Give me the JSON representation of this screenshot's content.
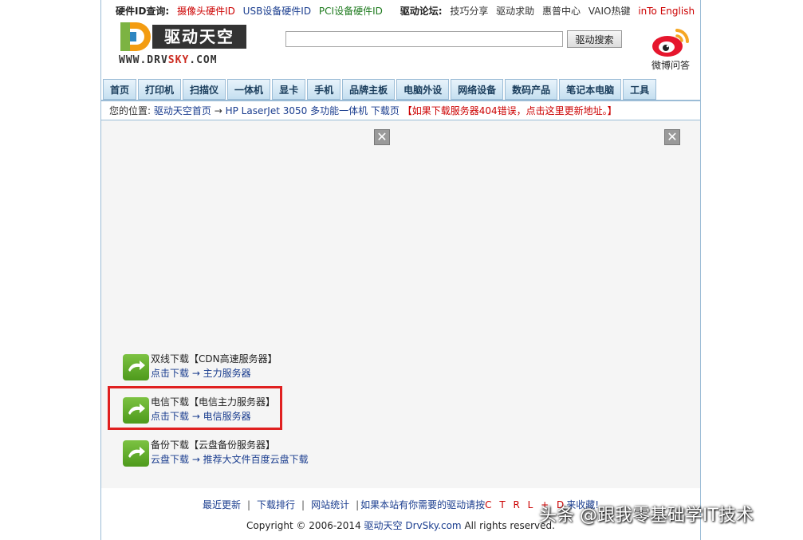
{
  "topbar": {
    "hwid_label": "硬件ID查询:",
    "camera_id": "摄像头硬件ID",
    "usb_id": "USB设备硬件ID",
    "pci_id": "PCI设备硬件ID",
    "forum_label": "驱动论坛:",
    "tips": "技巧分享",
    "help": "驱动求助",
    "hp_center": "惠普中心",
    "vaio": "VAIO热键",
    "english": "inTo English"
  },
  "logo": {
    "cn": "驱动天空",
    "url_prefix": "WWW.DRV",
    "url_sky": "SKY",
    "url_suffix": ".COM"
  },
  "search": {
    "value": "",
    "button": "驱动搜索"
  },
  "weibo": {
    "label": "微博问答"
  },
  "nav": {
    "items": [
      "首页",
      "打印机",
      "扫描仪",
      "一体机",
      "显卡",
      "手机",
      "品牌主板",
      "电脑外设",
      "网络设备",
      "数码产品",
      "笔记本电脑",
      "工具"
    ]
  },
  "breadcrumb": {
    "prefix": "您的位置:",
    "home": "驱动天空首页",
    "arrow": "→",
    "page": "HP LaserJet 3050 多功能一体机 下载页",
    "notice": "【如果下载服务器404错误，点击这里更新地址。】"
  },
  "downloads": [
    {
      "title": "双线下载【CDN高速服务器】",
      "link": "点击下载 → 主力服务器"
    },
    {
      "title": "电信下载【电信主力服务器】",
      "link": "点击下载 → 电信服务器"
    },
    {
      "title": "备份下载【云盘备份服务器】",
      "link": "云盘下载 → 推荐大文件百度云盘下载"
    }
  ],
  "footer": {
    "recent": "最近更新",
    "ranking": "下载排行",
    "stats": "网站统计",
    "bookmark_prefix": "如果本站有你需要的驱动请按",
    "ctrl": "C T R L + D",
    "bookmark_suffix": "来收藏!",
    "copyright_prefix": "Copyright © 2006-2014",
    "site_cn": "驱动天空",
    "site_en": "DrvSky.com",
    "copyright_suffix": "All rights reserved."
  },
  "watermark": "头条 @跟我零基础学IT技术",
  "colors": {
    "accent_red": "#cc0000",
    "link_blue": "#1a3d8f",
    "nav_border": "#9bbcd6",
    "highlight": "#e02020"
  }
}
